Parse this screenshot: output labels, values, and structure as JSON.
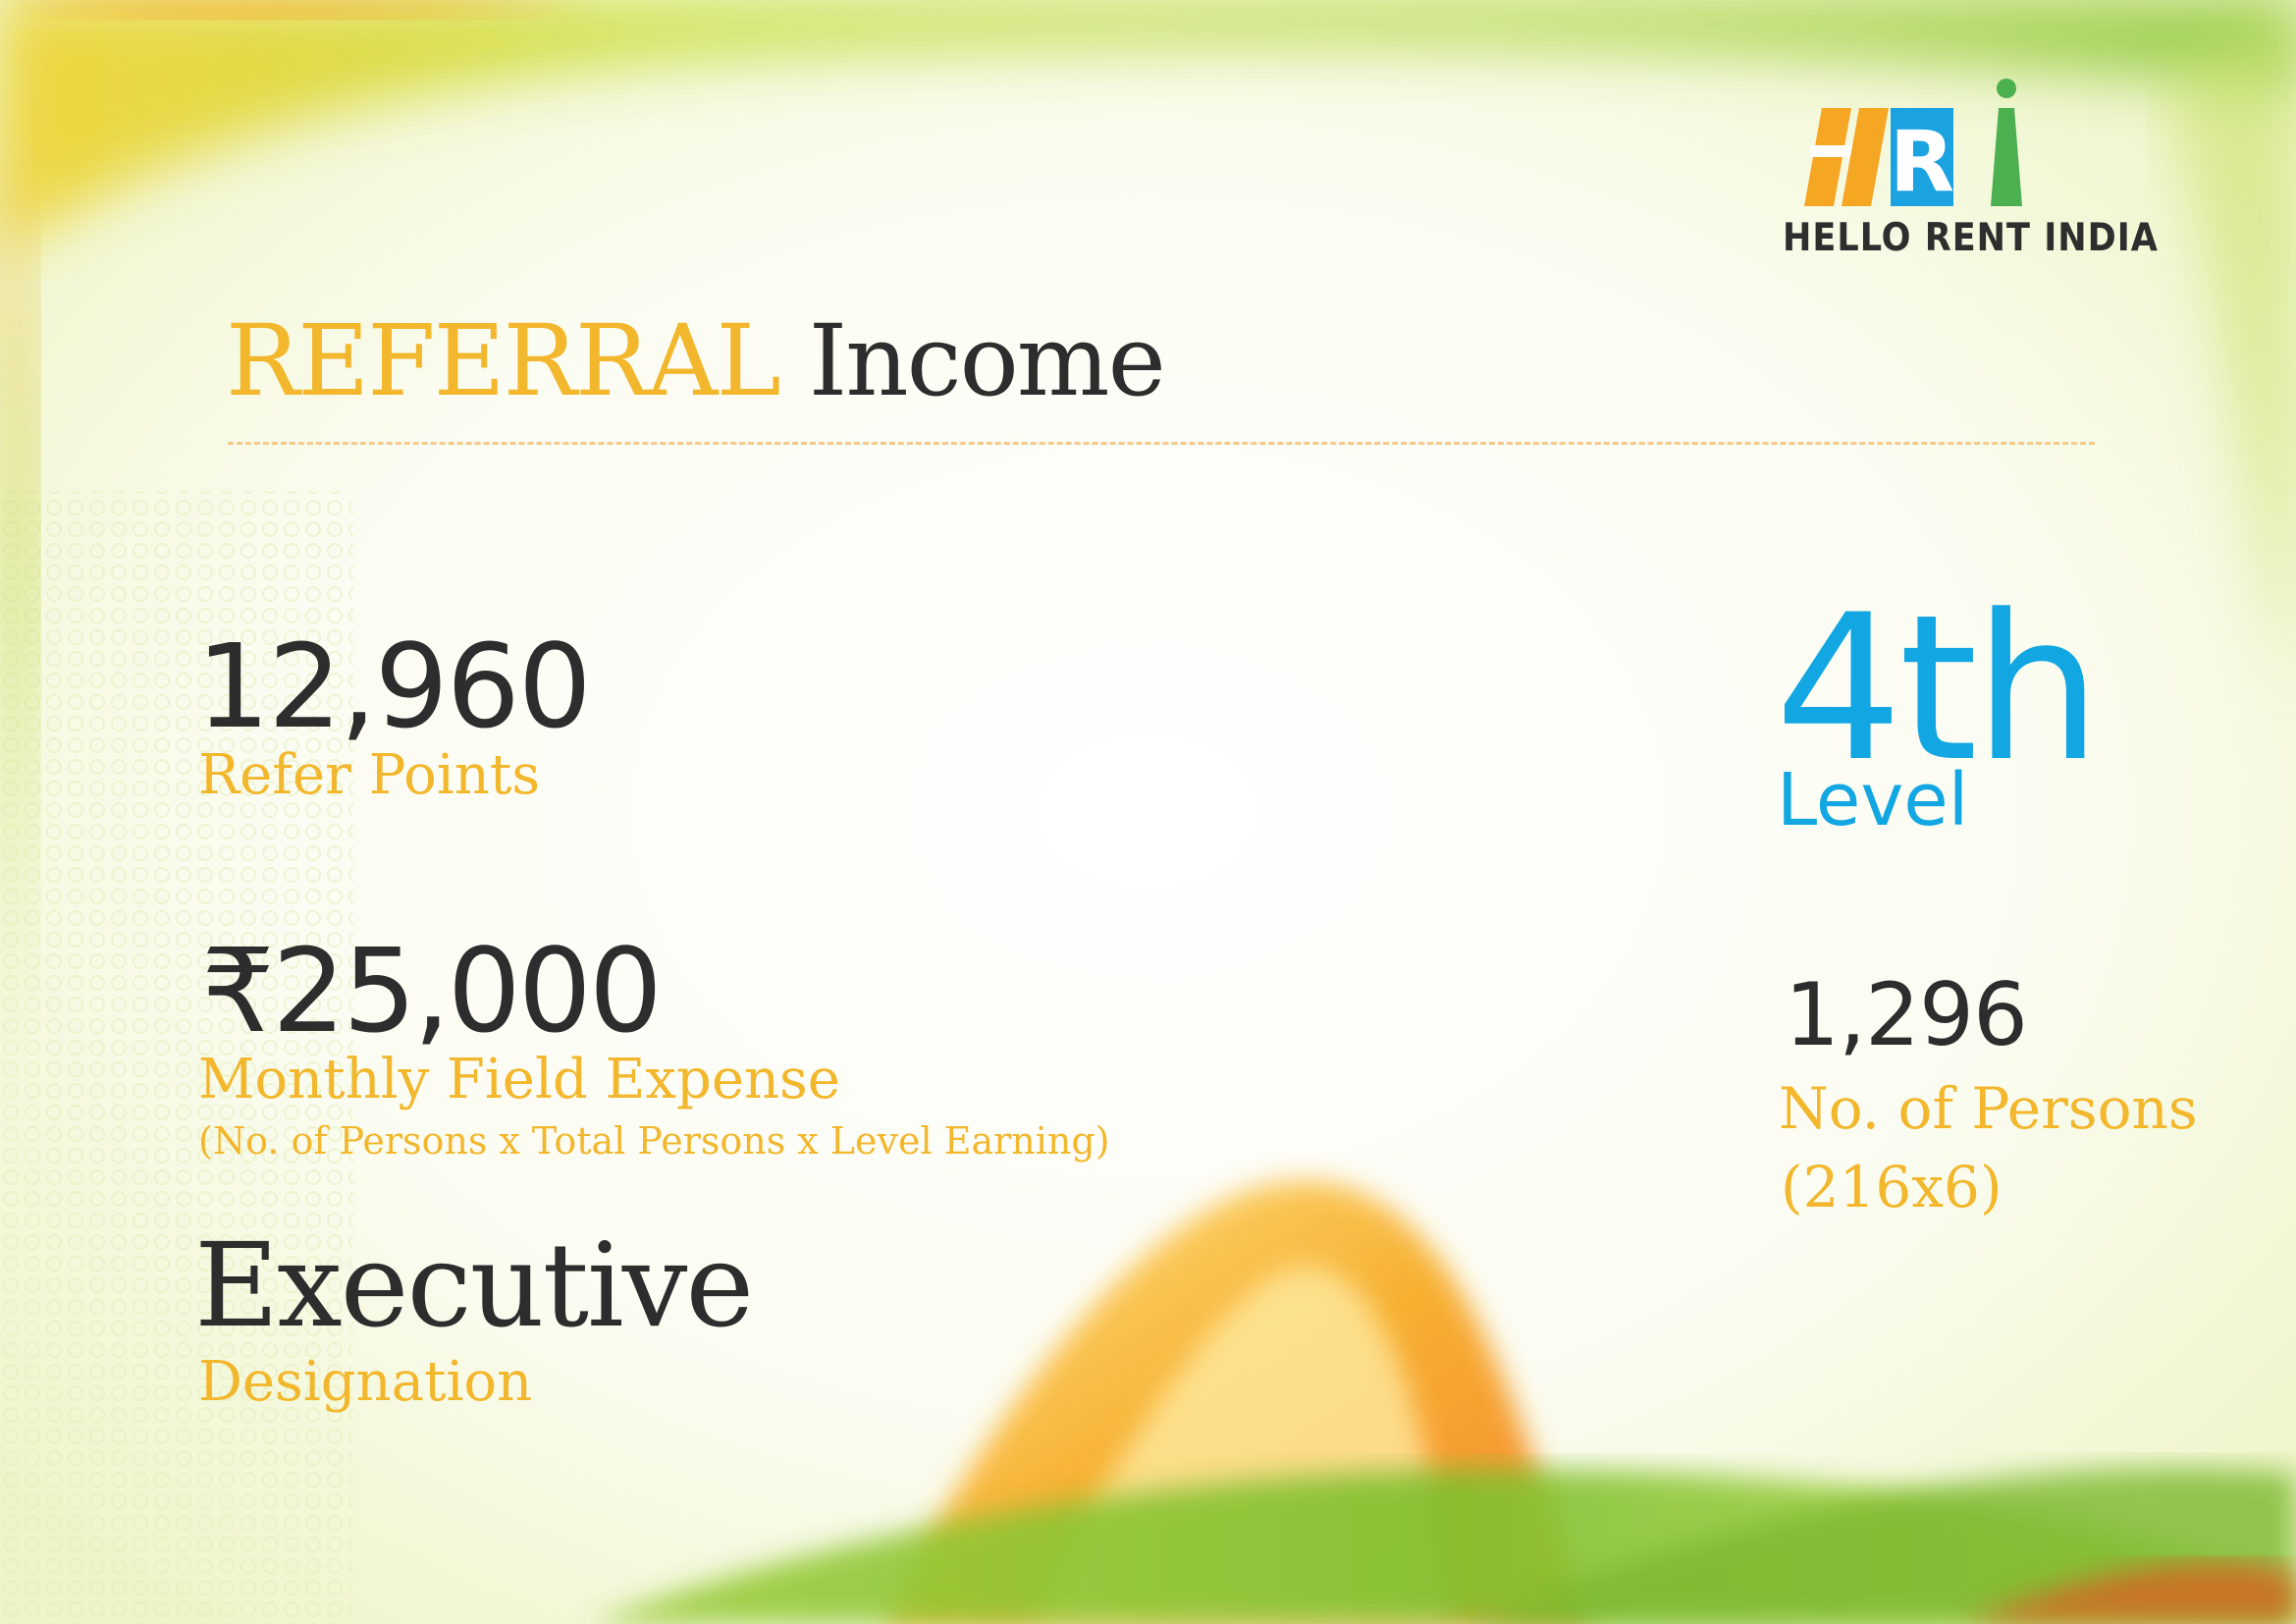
{
  "brand": {
    "name": "HELLO RENT INDIA"
  },
  "title": {
    "accent": "REFERRAL",
    "rest": "Income"
  },
  "stats": {
    "refer_points": {
      "value": "12,960",
      "label": "Refer Points"
    },
    "monthly_expense": {
      "value": "₹25,000",
      "label": "Monthly Field Expense",
      "formula": "(No. of Persons x Total Persons x Level Earning)"
    },
    "designation": {
      "value": "Executive",
      "label": "Designation"
    },
    "level": {
      "value": "4th",
      "label": "Level"
    },
    "persons": {
      "value": "1,296",
      "label": "No. of Persons",
      "formula": "(216x6)"
    }
  },
  "colors": {
    "accent": "#f2b72c",
    "level_blue": "#12a7e3",
    "text_dark": "#2d2d2d",
    "logo_orange": "#f5a623",
    "logo_blue": "#1aa3e0",
    "logo_green": "#4caf50"
  }
}
